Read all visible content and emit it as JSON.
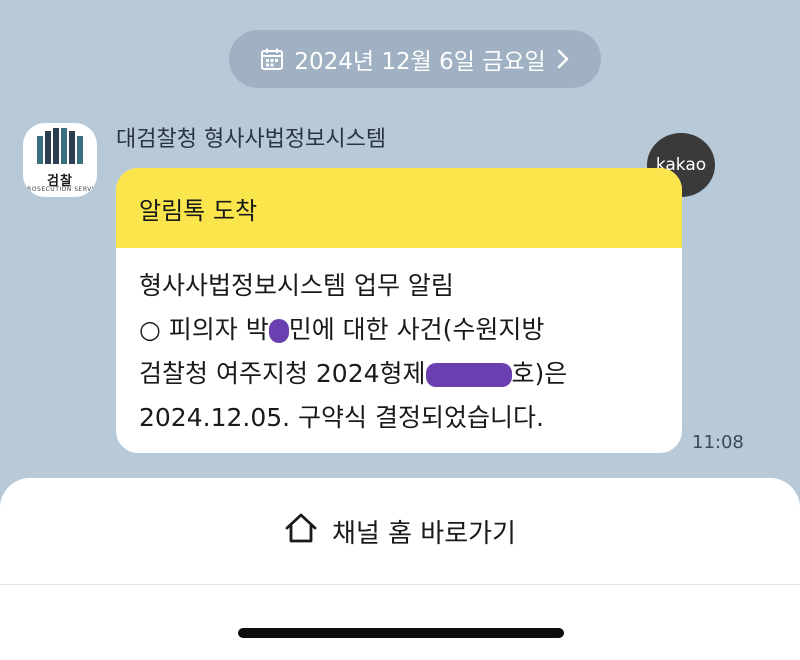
{
  "date_header": {
    "label": "2024년 12월 6일 금요일",
    "calendar_icon": "calendar-icon",
    "chevron_icon": "chevron-right-icon"
  },
  "sender": {
    "name": "대검찰청 형사사법정보시스템",
    "avatar_text": "검찰",
    "avatar_subtext": "PROSECUTION SERVICE"
  },
  "badge": {
    "label": "kakao"
  },
  "message": {
    "header": "알림톡 도착",
    "line1": "형사사법정보시스템 업무 알림",
    "line2_prefix": "○ 피의자 박",
    "line2_suffix": "민에 대한 사건(수원지방",
    "line3_prefix": "검찰청 여주지청 2024형제",
    "line3_suffix": "호)은",
    "line4": "2024.12.05. 구약식 결정되었습니다.",
    "time": "11:08"
  },
  "bottom": {
    "channel_home_label": "채널 홈 바로가기",
    "home_icon": "home-icon"
  },
  "colors": {
    "background": "#b8c9d8",
    "header_yellow": "#fbe54d",
    "redaction": "#6a3fb0"
  }
}
